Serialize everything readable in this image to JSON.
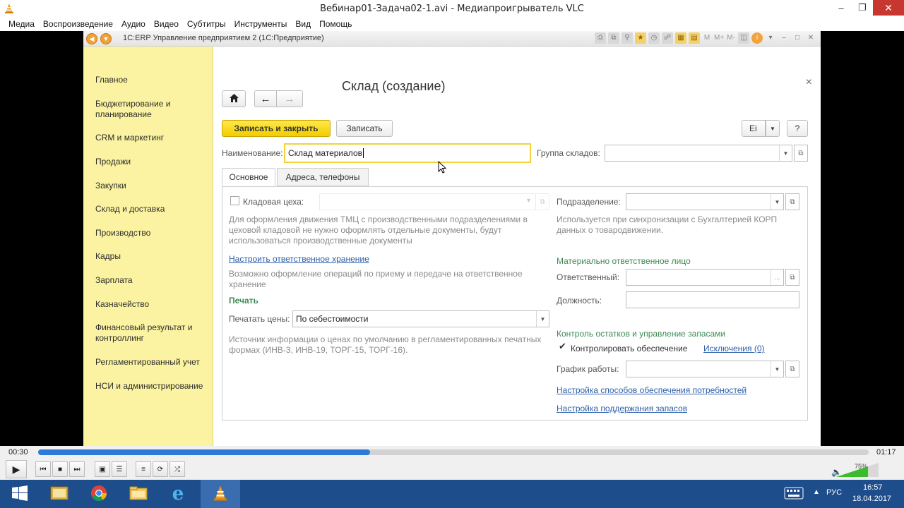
{
  "vlc": {
    "window_title": "Вебинар01-Задача02-1.avi - Медиапроигрыватель VLC",
    "menu": [
      "Медиа",
      "Воспроизведение",
      "Аудио",
      "Видео",
      "Субтитры",
      "Инструменты",
      "Вид",
      "Помощь"
    ],
    "time_elapsed": "00:30",
    "time_total": "01:17",
    "progress": 0.4,
    "volume_label": "75%",
    "volume": 0.75
  },
  "app": {
    "title": "1С:ERP Управление предприятием 2  (1С:Предприятие)",
    "toolbar_letters": [
      "M",
      "M+",
      "M-"
    ],
    "sidebar": [
      "Главное",
      "Бюджетирование и планирование",
      "CRM и маркетинг",
      "Продажи",
      "Закупки",
      "Склад и доставка",
      "Производство",
      "Кадры",
      "Зарплата",
      "Казначейство",
      "Финансовый результат и контроллинг",
      "Регламентированный учет",
      "НСИ и администрирование"
    ]
  },
  "form": {
    "title": "Склад (создание)",
    "save_close_label": "Записать и закрыть",
    "save_label": "Записать",
    "more_label": "Ei",
    "help_label": "?",
    "name_label": "Наименование:",
    "name_value": "Склад материалов",
    "group_label": "Группа складов:",
    "tabs": [
      "Основное",
      "Адреса, телефоны"
    ],
    "left": {
      "workshop_label": "Кладовая цеха:",
      "workshop_hint": "Для оформления движения ТМЦ с производственными подразделениями в цеховой кладовой не нужно оформлять отдельные документы, будут использоваться производственные документы",
      "responsible_link": "Настроить ответственное хранение",
      "responsible_hint": "Возможно оформление операций по приему и передаче на ответственное хранение",
      "print_group": "Печать",
      "print_prices_label": "Печатать цены:",
      "print_prices_value": "По себестоимости",
      "print_hint": "Источник информации о ценах по умолчанию в регламентированных печатных формах (ИНВ-3, ИНВ-19, ТОРГ-15, ТОРГ-16)."
    },
    "right": {
      "division_label": "Подразделение:",
      "division_hint": "Используется при синхронизации с Бухгалтерией КОРП данных о товародвижении.",
      "mol_group": "Материально ответственное лицо",
      "responsible_label": "Ответственный:",
      "position_label": "Должность:",
      "stock_group": "Контроль остатков и управление запасами",
      "control_label": "Контролировать обеспечение",
      "exceptions_link": "Исключения (0)",
      "schedule_label": "График работы:",
      "link_supply": "Настройка способов обеспечения потребностей",
      "link_stock": "Настройка поддержания запасов"
    }
  },
  "taskbar": {
    "lang": "РУС",
    "time": "16:57",
    "date": "18.04.2017"
  }
}
